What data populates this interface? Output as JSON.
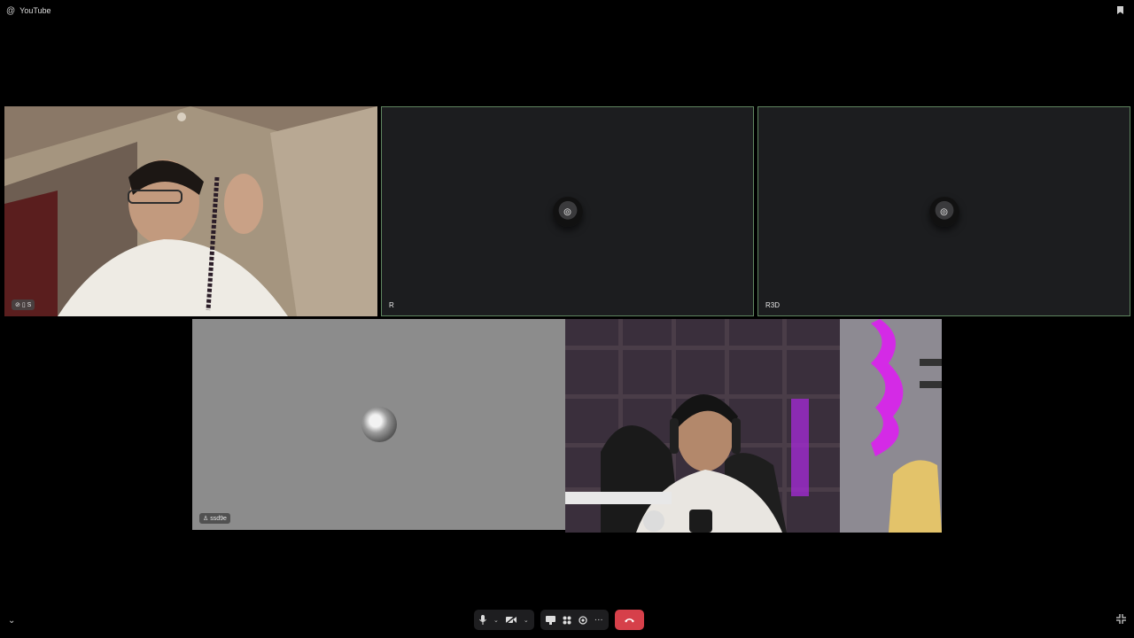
{
  "app": {
    "channel_name": "YouTube",
    "channel_icon": "at-icon",
    "bookmark_icon": "bookmark-icon"
  },
  "participants": [
    {
      "label": "S",
      "type": "camera",
      "status_icons": [
        "mic-off-icon",
        "screen-icon"
      ]
    },
    {
      "label": "R",
      "type": "avatar-placeholder"
    },
    {
      "label": "R3D",
      "type": "avatar-placeholder"
    },
    {
      "label": "ssd9e",
      "type": "avatar",
      "badge_icon": "playstation-icon"
    },
    {
      "label": "",
      "type": "camera"
    }
  ],
  "controls": {
    "mic_icon": "microphone-icon",
    "camera_icon": "camera-off-icon",
    "screenshare_icon": "screen-share-icon",
    "activities_icon": "activities-icon",
    "soundboard_icon": "soundboard-icon",
    "more_icon": "more-icon",
    "end_call_icon": "end-call-icon"
  },
  "colors": {
    "background": "#000000",
    "tile_border_active": "#5f8560",
    "end_call": "#d6404a",
    "placeholder_tile": "#1c1d1f",
    "gray_tile": "#8c8c8c"
  }
}
